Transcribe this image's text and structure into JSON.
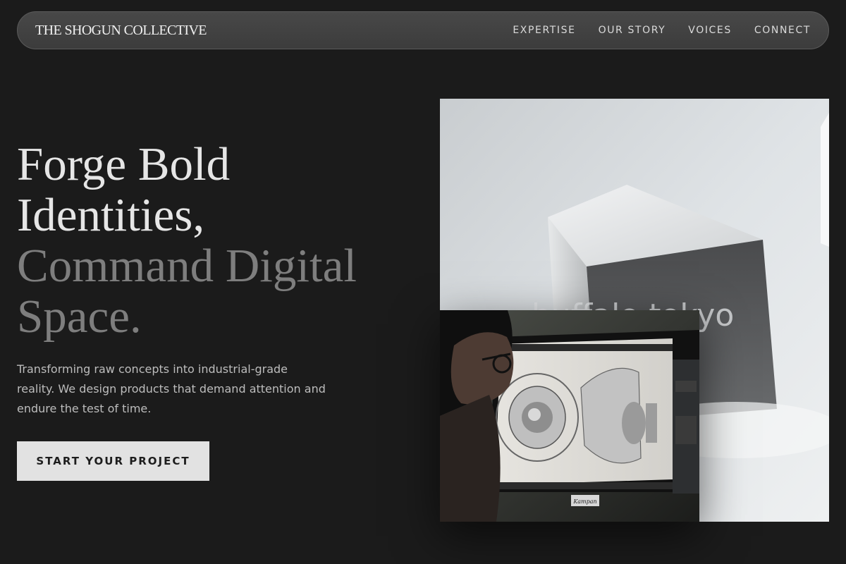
{
  "header": {
    "brand": "THE SHOGUN COLLECTIVE",
    "nav": [
      {
        "label": "EXPERTISE"
      },
      {
        "label": "OUR STORY"
      },
      {
        "label": "VOICES"
      },
      {
        "label": "CONNECT"
      }
    ]
  },
  "hero": {
    "headline_lines": [
      "Forge Bold",
      "Identities,",
      "Command Digital",
      "Space."
    ],
    "description": "Transforming raw concepts into industrial-grade reality. We design products that demand attention and endure the test of time.",
    "cta_label": "START YOUR PROJECT"
  },
  "images": {
    "back_caption": "buffalo tokyo",
    "monitor_brand": "Kampan"
  },
  "colors": {
    "background": "#1b1b1b",
    "nav_background": "#424242",
    "headline_primary": "#e6e6e6",
    "headline_secondary": "#7e7e7e",
    "cta_background": "#e2e2e2"
  }
}
